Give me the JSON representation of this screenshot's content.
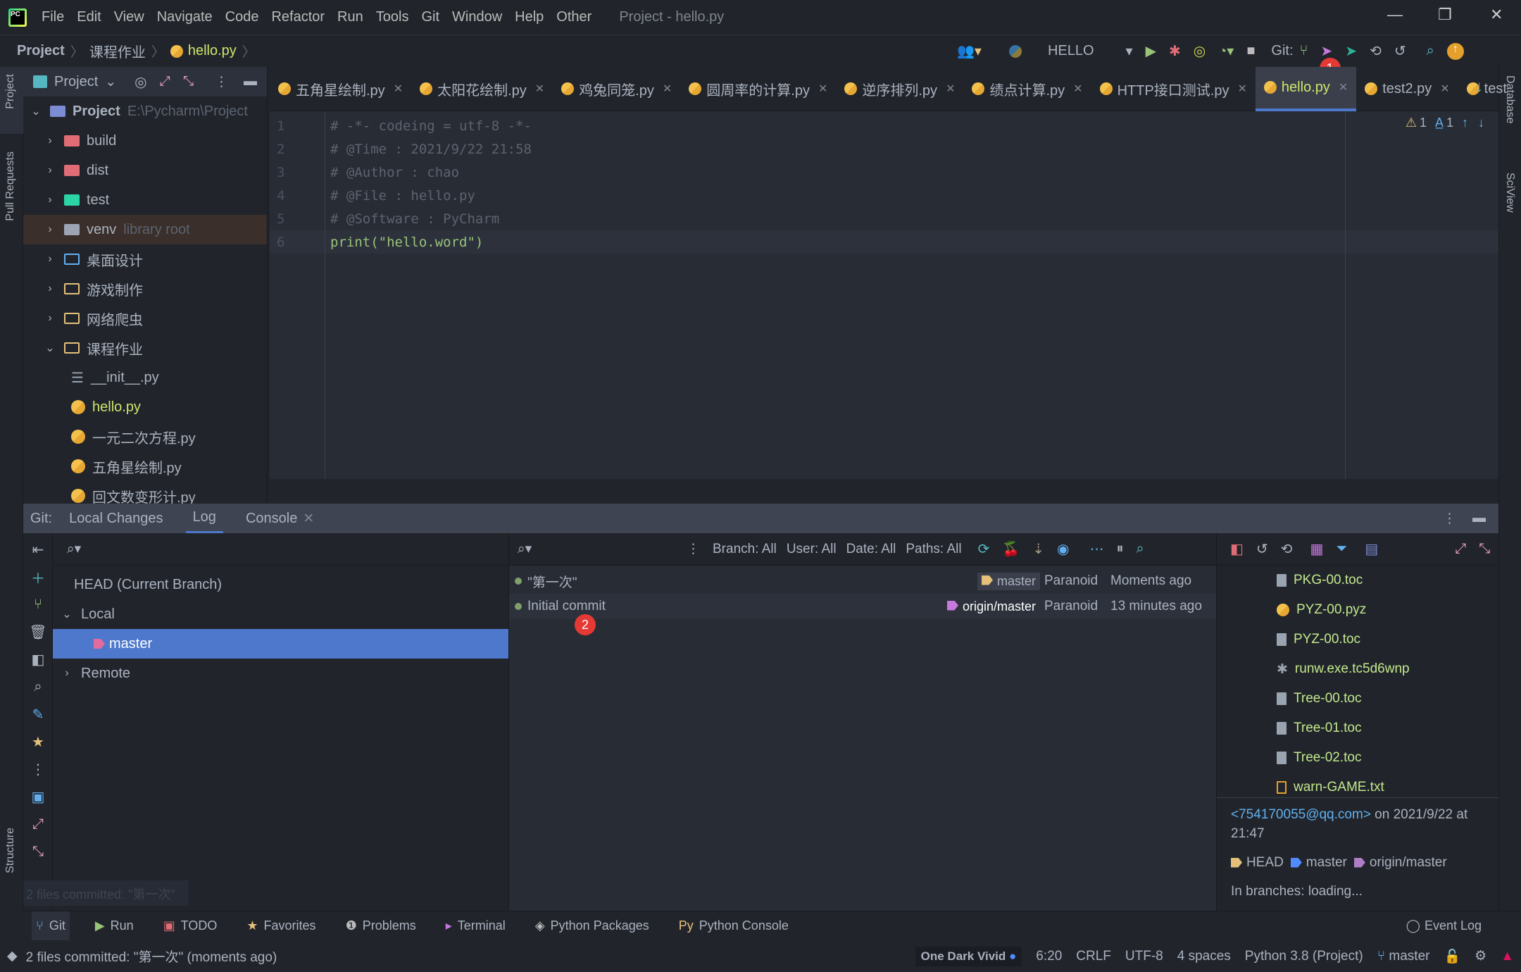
{
  "menubar": {
    "items": [
      "File",
      "Edit",
      "View",
      "Navigate",
      "Code",
      "Refactor",
      "Run",
      "Tools",
      "Git",
      "Window",
      "Help",
      "Other"
    ],
    "window_title": "Project - hello.py"
  },
  "breadcrumb": [
    "Project",
    "课程作业",
    "hello.py"
  ],
  "toolbar": {
    "run_config": "HELLO",
    "git_label": "Git:",
    "badge": "1"
  },
  "stripes": {
    "left_top": [
      "Project",
      "Pull Requests"
    ],
    "left_bottom": "Structure",
    "right": [
      "Database",
      "SciView"
    ]
  },
  "project_panel": {
    "title": "Project",
    "root": {
      "name": "Project",
      "path": "E:\\Pycharm\\Project"
    },
    "items": [
      {
        "name": "build",
        "type": "excluded",
        "expanded": false
      },
      {
        "name": "dist",
        "type": "excluded",
        "expanded": false
      },
      {
        "name": "test",
        "type": "test",
        "expanded": false
      },
      {
        "name": "venv",
        "hint": "library root",
        "type": "library",
        "expanded": false
      },
      {
        "name": "桌面设计",
        "type": "folder",
        "expanded": false
      },
      {
        "name": "游戏制作",
        "type": "package",
        "expanded": false
      },
      {
        "name": "网络爬虫",
        "type": "package",
        "expanded": false
      },
      {
        "name": "课程作业",
        "type": "package",
        "expanded": true
      },
      {
        "name": "__init__.py",
        "type": "init",
        "child": true
      },
      {
        "name": "hello.py",
        "type": "python",
        "child": true,
        "modified": true
      },
      {
        "name": "一元二次方程.py",
        "type": "python",
        "child": true
      },
      {
        "name": "五角星绘制.py",
        "type": "python",
        "child": true
      },
      {
        "name": "回文数变形计.py",
        "type": "python",
        "child": true
      }
    ]
  },
  "tabs": [
    {
      "label": "五角星绘制.py"
    },
    {
      "label": "太阳花绘制.py"
    },
    {
      "label": "鸡兔同笼.py"
    },
    {
      "label": "圆周率的计算.py"
    },
    {
      "label": "逆序排列.py"
    },
    {
      "label": "绩点计算.py"
    },
    {
      "label": "HTTP接口测试.py"
    },
    {
      "label": "hello.py",
      "active": true
    },
    {
      "label": "test2.py"
    },
    {
      "label": "test"
    }
  ],
  "editor": {
    "lines": [
      "# -*- codeing = utf-8 -*-",
      "# @Time : 2021/9/22 21:58",
      "# @Author : chao",
      "# @File : hello.py",
      "# @Software : PyCharm",
      "print(\"hello.word\")"
    ],
    "inspections": {
      "warnings": "1",
      "typos": "1"
    }
  },
  "git_panel": {
    "label": "Git:",
    "tabs": [
      "Local Changes",
      "Log",
      "Console"
    ],
    "active_tab": "Log",
    "branches": {
      "head": "HEAD (Current Branch)",
      "local": "Local",
      "local_branches": [
        "master"
      ],
      "remote": "Remote"
    },
    "filters": [
      "Branch: All",
      "User: All",
      "Date: All",
      "Paths: All"
    ],
    "commits": [
      {
        "message": "\"第一次\"",
        "tag": "master",
        "author": "Paranoid",
        "date": "Moments ago"
      },
      {
        "message": "Initial commit",
        "tag": "origin/master",
        "author": "Paranoid",
        "date": "13 minutes ago"
      }
    ],
    "badge": "2",
    "files": [
      "PKG-00.toc",
      "PYZ-00.pyz",
      "PYZ-00.toc",
      "runw.exe.tc5d6wnp",
      "Tree-00.toc",
      "Tree-01.toc",
      "Tree-02.toc",
      "warn-GAME.txt"
    ],
    "details": {
      "email": "<754170055@qq.com>",
      "date_text": "on 2021/9/22 at 21:47",
      "refs": [
        "HEAD",
        "master",
        "origin/master"
      ],
      "in_branches": "In branches: loading..."
    },
    "notification": "2 files committed: \"第一次\""
  },
  "tool_windows": [
    "Git",
    "Run",
    "TODO",
    "Favorites",
    "Problems",
    "Terminal",
    "Python Packages",
    "Python Console"
  ],
  "event_log": "Event Log",
  "status": {
    "message": "2 files committed: \"第一次\" (moments ago)",
    "theme": "One Dark Vivid",
    "position": "6:20",
    "line_sep": "CRLF",
    "encoding": "UTF-8",
    "indent": "4 spaces",
    "interpreter": "Python 3.8 (Project)",
    "branch": "master"
  },
  "colors": {
    "accent": "#4d78cc",
    "bg": "#21252b",
    "editor_bg": "#282c34",
    "badge": "#e53935"
  }
}
